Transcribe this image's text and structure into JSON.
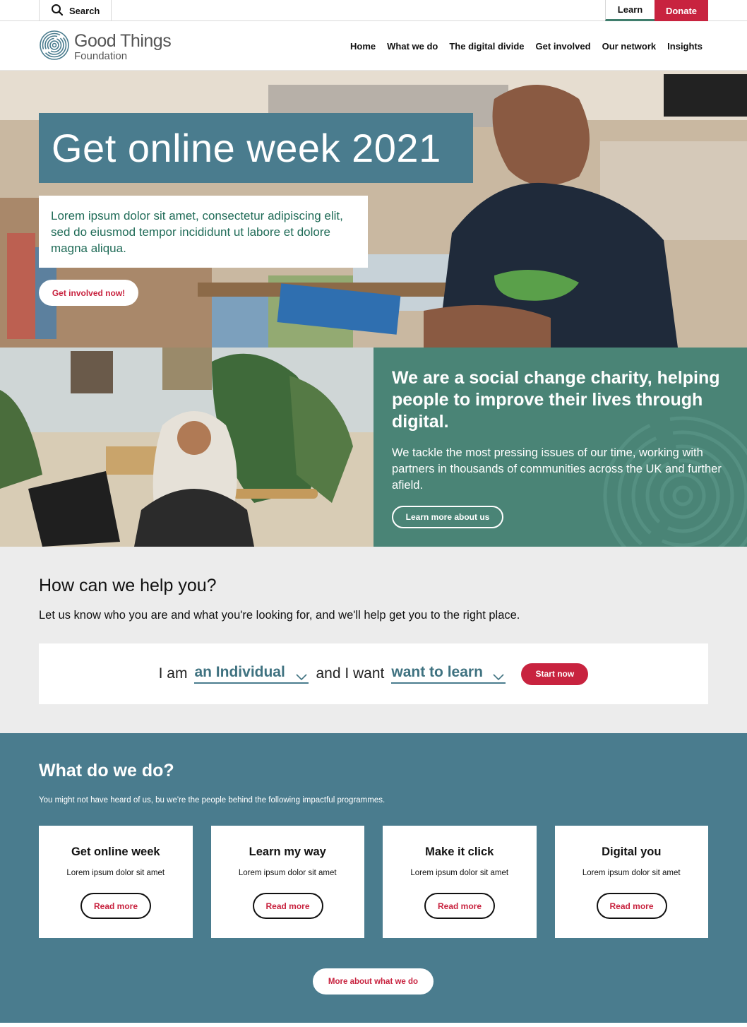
{
  "utility": {
    "search_label": "Search",
    "learn_label": "Learn",
    "donate_label": "Donate"
  },
  "logo": {
    "name_line1": "Good Things",
    "name_line2": "Foundation"
  },
  "nav": {
    "items": [
      "Home",
      "What we do",
      "The digital divide",
      "Get involved",
      "Our network",
      "Insights"
    ]
  },
  "hero": {
    "title": "Get online week 2021",
    "text": "Lorem ipsum dolor sit amet, consectetur adipiscing elit, sed do eiusmod tempor incididunt ut labore et dolore magna aliqua.",
    "cta_label": "Get involved now!"
  },
  "mission": {
    "heading": "We are a social change charity, helping people to improve their lives through digital.",
    "text": "We tackle the most pressing issues of our time, working with partners in thousands of communities across the UK and further afield.",
    "cta_label": "Learn more about us"
  },
  "help": {
    "title": "How can we help you?",
    "subtitle": "Let us know who you are and what you're looking for, and we'll help get you to the right place.",
    "prefix_text": "I am",
    "who_selected": "an Individual",
    "middle_text": "and I want",
    "want_selected": "want to learn",
    "start_label": "Start now"
  },
  "what": {
    "title": "What do we do?",
    "subtitle": "You might not have heard of us, bu we're the people behind the following impactful programmes.",
    "cards": [
      {
        "title": "Get online week",
        "text": "Lorem ipsum dolor sit amet",
        "button": "Read more"
      },
      {
        "title": "Learn my way",
        "text": "Lorem ipsum dolor sit amet",
        "button": "Read more"
      },
      {
        "title": "Make it click",
        "text": "Lorem ipsum dolor sit amet",
        "button": "Read more"
      },
      {
        "title": "Digital you",
        "text": "Lorem ipsum dolor sit amet",
        "button": "Read more"
      }
    ],
    "more_label": "More about what we do"
  },
  "colors": {
    "brand_red": "#c8233f",
    "brand_blue": "#4a7c8e",
    "brand_green": "#4a8476",
    "light_grey": "#ececec"
  }
}
